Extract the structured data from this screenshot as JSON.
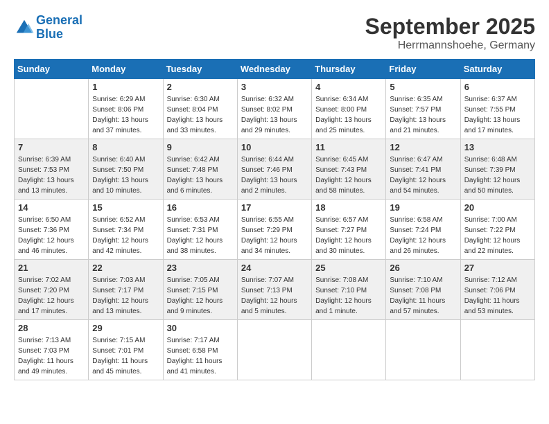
{
  "header": {
    "logo_line1": "General",
    "logo_line2": "Blue",
    "month": "September 2025",
    "location": "Herrmannshoehe, Germany"
  },
  "days_of_week": [
    "Sunday",
    "Monday",
    "Tuesday",
    "Wednesday",
    "Thursday",
    "Friday",
    "Saturday"
  ],
  "weeks": [
    [
      {
        "day": "",
        "sunrise": "",
        "sunset": "",
        "daylight": ""
      },
      {
        "day": "1",
        "sunrise": "Sunrise: 6:29 AM",
        "sunset": "Sunset: 8:06 PM",
        "daylight": "Daylight: 13 hours and 37 minutes."
      },
      {
        "day": "2",
        "sunrise": "Sunrise: 6:30 AM",
        "sunset": "Sunset: 8:04 PM",
        "daylight": "Daylight: 13 hours and 33 minutes."
      },
      {
        "day": "3",
        "sunrise": "Sunrise: 6:32 AM",
        "sunset": "Sunset: 8:02 PM",
        "daylight": "Daylight: 13 hours and 29 minutes."
      },
      {
        "day": "4",
        "sunrise": "Sunrise: 6:34 AM",
        "sunset": "Sunset: 8:00 PM",
        "daylight": "Daylight: 13 hours and 25 minutes."
      },
      {
        "day": "5",
        "sunrise": "Sunrise: 6:35 AM",
        "sunset": "Sunset: 7:57 PM",
        "daylight": "Daylight: 13 hours and 21 minutes."
      },
      {
        "day": "6",
        "sunrise": "Sunrise: 6:37 AM",
        "sunset": "Sunset: 7:55 PM",
        "daylight": "Daylight: 13 hours and 17 minutes."
      }
    ],
    [
      {
        "day": "7",
        "sunrise": "Sunrise: 6:39 AM",
        "sunset": "Sunset: 7:53 PM",
        "daylight": "Daylight: 13 hours and 13 minutes."
      },
      {
        "day": "8",
        "sunrise": "Sunrise: 6:40 AM",
        "sunset": "Sunset: 7:50 PM",
        "daylight": "Daylight: 13 hours and 10 minutes."
      },
      {
        "day": "9",
        "sunrise": "Sunrise: 6:42 AM",
        "sunset": "Sunset: 7:48 PM",
        "daylight": "Daylight: 13 hours and 6 minutes."
      },
      {
        "day": "10",
        "sunrise": "Sunrise: 6:44 AM",
        "sunset": "Sunset: 7:46 PM",
        "daylight": "Daylight: 13 hours and 2 minutes."
      },
      {
        "day": "11",
        "sunrise": "Sunrise: 6:45 AM",
        "sunset": "Sunset: 7:43 PM",
        "daylight": "Daylight: 12 hours and 58 minutes."
      },
      {
        "day": "12",
        "sunrise": "Sunrise: 6:47 AM",
        "sunset": "Sunset: 7:41 PM",
        "daylight": "Daylight: 12 hours and 54 minutes."
      },
      {
        "day": "13",
        "sunrise": "Sunrise: 6:48 AM",
        "sunset": "Sunset: 7:39 PM",
        "daylight": "Daylight: 12 hours and 50 minutes."
      }
    ],
    [
      {
        "day": "14",
        "sunrise": "Sunrise: 6:50 AM",
        "sunset": "Sunset: 7:36 PM",
        "daylight": "Daylight: 12 hours and 46 minutes."
      },
      {
        "day": "15",
        "sunrise": "Sunrise: 6:52 AM",
        "sunset": "Sunset: 7:34 PM",
        "daylight": "Daylight: 12 hours and 42 minutes."
      },
      {
        "day": "16",
        "sunrise": "Sunrise: 6:53 AM",
        "sunset": "Sunset: 7:31 PM",
        "daylight": "Daylight: 12 hours and 38 minutes."
      },
      {
        "day": "17",
        "sunrise": "Sunrise: 6:55 AM",
        "sunset": "Sunset: 7:29 PM",
        "daylight": "Daylight: 12 hours and 34 minutes."
      },
      {
        "day": "18",
        "sunrise": "Sunrise: 6:57 AM",
        "sunset": "Sunset: 7:27 PM",
        "daylight": "Daylight: 12 hours and 30 minutes."
      },
      {
        "day": "19",
        "sunrise": "Sunrise: 6:58 AM",
        "sunset": "Sunset: 7:24 PM",
        "daylight": "Daylight: 12 hours and 26 minutes."
      },
      {
        "day": "20",
        "sunrise": "Sunrise: 7:00 AM",
        "sunset": "Sunset: 7:22 PM",
        "daylight": "Daylight: 12 hours and 22 minutes."
      }
    ],
    [
      {
        "day": "21",
        "sunrise": "Sunrise: 7:02 AM",
        "sunset": "Sunset: 7:20 PM",
        "daylight": "Daylight: 12 hours and 17 minutes."
      },
      {
        "day": "22",
        "sunrise": "Sunrise: 7:03 AM",
        "sunset": "Sunset: 7:17 PM",
        "daylight": "Daylight: 12 hours and 13 minutes."
      },
      {
        "day": "23",
        "sunrise": "Sunrise: 7:05 AM",
        "sunset": "Sunset: 7:15 PM",
        "daylight": "Daylight: 12 hours and 9 minutes."
      },
      {
        "day": "24",
        "sunrise": "Sunrise: 7:07 AM",
        "sunset": "Sunset: 7:13 PM",
        "daylight": "Daylight: 12 hours and 5 minutes."
      },
      {
        "day": "25",
        "sunrise": "Sunrise: 7:08 AM",
        "sunset": "Sunset: 7:10 PM",
        "daylight": "Daylight: 12 hours and 1 minute."
      },
      {
        "day": "26",
        "sunrise": "Sunrise: 7:10 AM",
        "sunset": "Sunset: 7:08 PM",
        "daylight": "Daylight: 11 hours and 57 minutes."
      },
      {
        "day": "27",
        "sunrise": "Sunrise: 7:12 AM",
        "sunset": "Sunset: 7:06 PM",
        "daylight": "Daylight: 11 hours and 53 minutes."
      }
    ],
    [
      {
        "day": "28",
        "sunrise": "Sunrise: 7:13 AM",
        "sunset": "Sunset: 7:03 PM",
        "daylight": "Daylight: 11 hours and 49 minutes."
      },
      {
        "day": "29",
        "sunrise": "Sunrise: 7:15 AM",
        "sunset": "Sunset: 7:01 PM",
        "daylight": "Daylight: 11 hours and 45 minutes."
      },
      {
        "day": "30",
        "sunrise": "Sunrise: 7:17 AM",
        "sunset": "Sunset: 6:58 PM",
        "daylight": "Daylight: 11 hours and 41 minutes."
      },
      {
        "day": "",
        "sunrise": "",
        "sunset": "",
        "daylight": ""
      },
      {
        "day": "",
        "sunrise": "",
        "sunset": "",
        "daylight": ""
      },
      {
        "day": "",
        "sunrise": "",
        "sunset": "",
        "daylight": ""
      },
      {
        "day": "",
        "sunrise": "",
        "sunset": "",
        "daylight": ""
      }
    ]
  ]
}
